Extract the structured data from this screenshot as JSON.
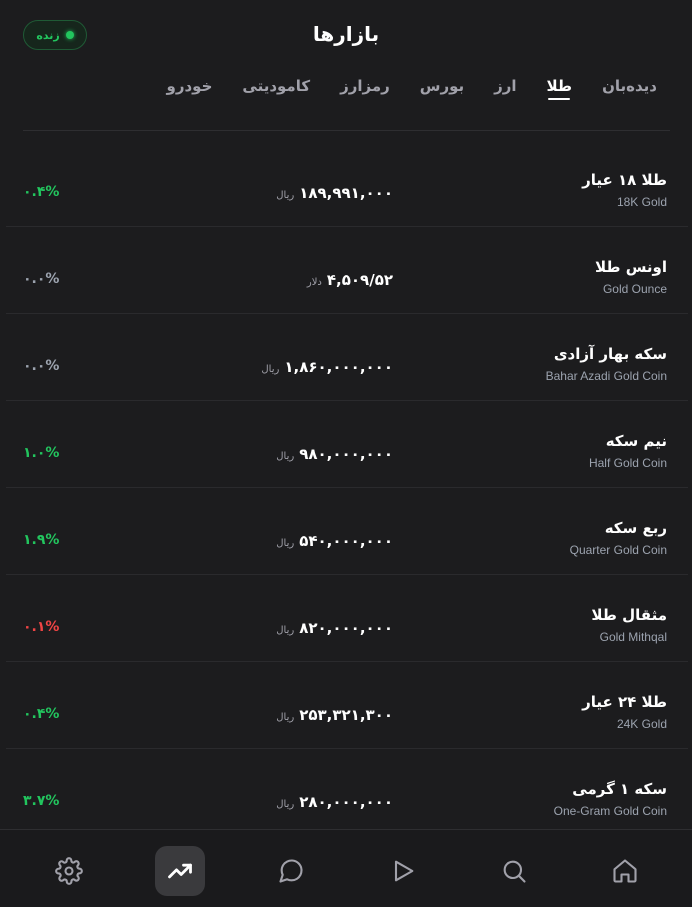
{
  "header": {
    "title": "بازارها",
    "live_label": "زنده"
  },
  "tabs": [
    {
      "label": "دیده‌بان",
      "active": false
    },
    {
      "label": "طلا",
      "active": true
    },
    {
      "label": "ارز",
      "active": false
    },
    {
      "label": "بورس",
      "active": false
    },
    {
      "label": "رمزارز",
      "active": false
    },
    {
      "label": "کامودیتی",
      "active": false
    },
    {
      "label": "خودرو",
      "active": false
    }
  ],
  "items": [
    {
      "name_fa": "طلا ۱۸ عیار",
      "name_en": "18K Gold",
      "price": "۱۸۹,۹۹۱,۰۰۰",
      "unit": "ریال",
      "change": "۰.۴%",
      "trend": "up"
    },
    {
      "name_fa": "اونس طلا",
      "name_en": "Gold Ounce",
      "price": "۴,۵۰۹/۵۲",
      "unit": "دلار",
      "change": "۰.۰%",
      "trend": "flat"
    },
    {
      "name_fa": "سکه بهار آزادی",
      "name_en": "Bahar Azadi Gold Coin",
      "price": "۱,۸۶۰,۰۰۰,۰۰۰",
      "unit": "ریال",
      "change": "۰.۰%",
      "trend": "flat"
    },
    {
      "name_fa": "نیم سکه",
      "name_en": "Half Gold Coin",
      "price": "۹۸۰,۰۰۰,۰۰۰",
      "unit": "ریال",
      "change": "۱.۰%",
      "trend": "up"
    },
    {
      "name_fa": "ربع سکه",
      "name_en": "Quarter Gold Coin",
      "price": "۵۴۰,۰۰۰,۰۰۰",
      "unit": "ریال",
      "change": "۱.۹%",
      "trend": "up"
    },
    {
      "name_fa": "مثقال طلا",
      "name_en": "Gold Mithqal",
      "price": "۸۲۰,۰۰۰,۰۰۰",
      "unit": "ریال",
      "change": "۰.۱%",
      "trend": "down"
    },
    {
      "name_fa": "طلا ۲۴ عیار",
      "name_en": "24K Gold",
      "price": "۲۵۳,۳۲۱,۳۰۰",
      "unit": "ریال",
      "change": "۰.۴%",
      "trend": "up"
    },
    {
      "name_fa": "سکه ۱ گرمی",
      "name_en": "One-Gram Gold Coin",
      "price": "۲۸۰,۰۰۰,۰۰۰",
      "unit": "ریال",
      "change": "۳.۷%",
      "trend": "up"
    }
  ],
  "nav": [
    {
      "icon": "settings-icon",
      "active": false
    },
    {
      "icon": "trending-up-icon",
      "active": true
    },
    {
      "icon": "chat-icon",
      "active": false
    },
    {
      "icon": "play-icon",
      "active": false
    },
    {
      "icon": "search-icon",
      "active": false
    },
    {
      "icon": "home-icon",
      "active": false
    }
  ],
  "colors": {
    "background": "#1c1c1e",
    "positive": "#22c55e",
    "negative": "#ef4444",
    "neutral": "#9ca3af"
  }
}
